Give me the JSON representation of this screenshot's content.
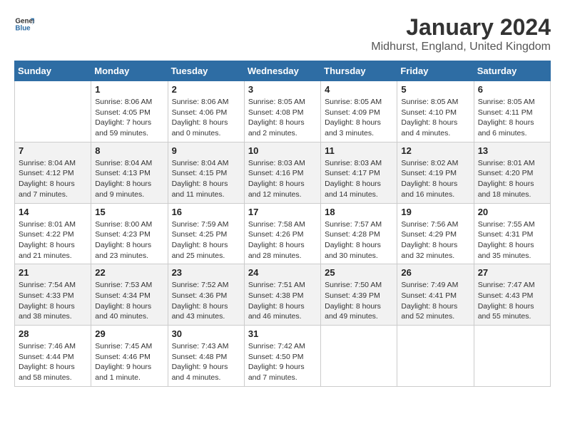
{
  "header": {
    "logo_general": "General",
    "logo_blue": "Blue",
    "title": "January 2024",
    "subtitle": "Midhurst, England, United Kingdom"
  },
  "calendar": {
    "days_of_week": [
      "Sunday",
      "Monday",
      "Tuesday",
      "Wednesday",
      "Thursday",
      "Friday",
      "Saturday"
    ],
    "weeks": [
      [
        {
          "day": "",
          "info": ""
        },
        {
          "day": "1",
          "info": "Sunrise: 8:06 AM\nSunset: 4:05 PM\nDaylight: 7 hours\nand 59 minutes."
        },
        {
          "day": "2",
          "info": "Sunrise: 8:06 AM\nSunset: 4:06 PM\nDaylight: 8 hours\nand 0 minutes."
        },
        {
          "day": "3",
          "info": "Sunrise: 8:05 AM\nSunset: 4:08 PM\nDaylight: 8 hours\nand 2 minutes."
        },
        {
          "day": "4",
          "info": "Sunrise: 8:05 AM\nSunset: 4:09 PM\nDaylight: 8 hours\nand 3 minutes."
        },
        {
          "day": "5",
          "info": "Sunrise: 8:05 AM\nSunset: 4:10 PM\nDaylight: 8 hours\nand 4 minutes."
        },
        {
          "day": "6",
          "info": "Sunrise: 8:05 AM\nSunset: 4:11 PM\nDaylight: 8 hours\nand 6 minutes."
        }
      ],
      [
        {
          "day": "7",
          "info": "Sunrise: 8:04 AM\nSunset: 4:12 PM\nDaylight: 8 hours\nand 7 minutes."
        },
        {
          "day": "8",
          "info": "Sunrise: 8:04 AM\nSunset: 4:13 PM\nDaylight: 8 hours\nand 9 minutes."
        },
        {
          "day": "9",
          "info": "Sunrise: 8:04 AM\nSunset: 4:15 PM\nDaylight: 8 hours\nand 11 minutes."
        },
        {
          "day": "10",
          "info": "Sunrise: 8:03 AM\nSunset: 4:16 PM\nDaylight: 8 hours\nand 12 minutes."
        },
        {
          "day": "11",
          "info": "Sunrise: 8:03 AM\nSunset: 4:17 PM\nDaylight: 8 hours\nand 14 minutes."
        },
        {
          "day": "12",
          "info": "Sunrise: 8:02 AM\nSunset: 4:19 PM\nDaylight: 8 hours\nand 16 minutes."
        },
        {
          "day": "13",
          "info": "Sunrise: 8:01 AM\nSunset: 4:20 PM\nDaylight: 8 hours\nand 18 minutes."
        }
      ],
      [
        {
          "day": "14",
          "info": "Sunrise: 8:01 AM\nSunset: 4:22 PM\nDaylight: 8 hours\nand 21 minutes."
        },
        {
          "day": "15",
          "info": "Sunrise: 8:00 AM\nSunset: 4:23 PM\nDaylight: 8 hours\nand 23 minutes."
        },
        {
          "day": "16",
          "info": "Sunrise: 7:59 AM\nSunset: 4:25 PM\nDaylight: 8 hours\nand 25 minutes."
        },
        {
          "day": "17",
          "info": "Sunrise: 7:58 AM\nSunset: 4:26 PM\nDaylight: 8 hours\nand 28 minutes."
        },
        {
          "day": "18",
          "info": "Sunrise: 7:57 AM\nSunset: 4:28 PM\nDaylight: 8 hours\nand 30 minutes."
        },
        {
          "day": "19",
          "info": "Sunrise: 7:56 AM\nSunset: 4:29 PM\nDaylight: 8 hours\nand 32 minutes."
        },
        {
          "day": "20",
          "info": "Sunrise: 7:55 AM\nSunset: 4:31 PM\nDaylight: 8 hours\nand 35 minutes."
        }
      ],
      [
        {
          "day": "21",
          "info": "Sunrise: 7:54 AM\nSunset: 4:33 PM\nDaylight: 8 hours\nand 38 minutes."
        },
        {
          "day": "22",
          "info": "Sunrise: 7:53 AM\nSunset: 4:34 PM\nDaylight: 8 hours\nand 40 minutes."
        },
        {
          "day": "23",
          "info": "Sunrise: 7:52 AM\nSunset: 4:36 PM\nDaylight: 8 hours\nand 43 minutes."
        },
        {
          "day": "24",
          "info": "Sunrise: 7:51 AM\nSunset: 4:38 PM\nDaylight: 8 hours\nand 46 minutes."
        },
        {
          "day": "25",
          "info": "Sunrise: 7:50 AM\nSunset: 4:39 PM\nDaylight: 8 hours\nand 49 minutes."
        },
        {
          "day": "26",
          "info": "Sunrise: 7:49 AM\nSunset: 4:41 PM\nDaylight: 8 hours\nand 52 minutes."
        },
        {
          "day": "27",
          "info": "Sunrise: 7:47 AM\nSunset: 4:43 PM\nDaylight: 8 hours\nand 55 minutes."
        }
      ],
      [
        {
          "day": "28",
          "info": "Sunrise: 7:46 AM\nSunset: 4:44 PM\nDaylight: 8 hours\nand 58 minutes."
        },
        {
          "day": "29",
          "info": "Sunrise: 7:45 AM\nSunset: 4:46 PM\nDaylight: 9 hours\nand 1 minute."
        },
        {
          "day": "30",
          "info": "Sunrise: 7:43 AM\nSunset: 4:48 PM\nDaylight: 9 hours\nand 4 minutes."
        },
        {
          "day": "31",
          "info": "Sunrise: 7:42 AM\nSunset: 4:50 PM\nDaylight: 9 hours\nand 7 minutes."
        },
        {
          "day": "",
          "info": ""
        },
        {
          "day": "",
          "info": ""
        },
        {
          "day": "",
          "info": ""
        }
      ]
    ]
  }
}
